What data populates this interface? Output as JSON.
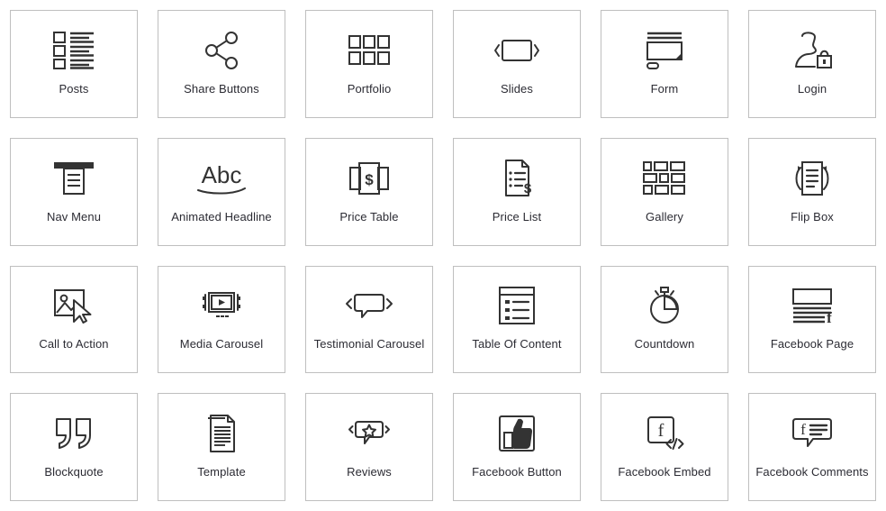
{
  "theme": {
    "background": "#ffffff",
    "card_border": "#bfbfbf",
    "icon_color": "#333333",
    "label_color": "#2b2b33"
  },
  "widget_grid": {
    "columns": 6,
    "rows": 4,
    "items": [
      {
        "label": "Posts",
        "icon": "posts-icon"
      },
      {
        "label": "Share Buttons",
        "icon": "share-buttons-icon"
      },
      {
        "label": "Portfolio",
        "icon": "portfolio-icon"
      },
      {
        "label": "Slides",
        "icon": "slides-icon"
      },
      {
        "label": "Form",
        "icon": "form-icon"
      },
      {
        "label": "Login",
        "icon": "login-icon"
      },
      {
        "label": "Nav Menu",
        "icon": "nav-menu-icon"
      },
      {
        "label": "Animated Headline",
        "icon": "animated-headline-icon"
      },
      {
        "label": "Price Table",
        "icon": "price-table-icon"
      },
      {
        "label": "Price List",
        "icon": "price-list-icon"
      },
      {
        "label": "Gallery",
        "icon": "gallery-icon"
      },
      {
        "label": "Flip Box",
        "icon": "flip-box-icon"
      },
      {
        "label": "Call to Action",
        "icon": "call-to-action-icon"
      },
      {
        "label": "Media Carousel",
        "icon": "media-carousel-icon"
      },
      {
        "label": "Testimonial Carousel",
        "icon": "testimonial-carousel-icon"
      },
      {
        "label": "Table Of Content",
        "icon": "table-of-content-icon"
      },
      {
        "label": "Countdown",
        "icon": "countdown-icon"
      },
      {
        "label": "Facebook Page",
        "icon": "facebook-page-icon"
      },
      {
        "label": "Blockquote",
        "icon": "blockquote-icon"
      },
      {
        "label": "Template",
        "icon": "template-icon"
      },
      {
        "label": "Reviews",
        "icon": "reviews-icon"
      },
      {
        "label": "Facebook Button",
        "icon": "facebook-button-icon"
      },
      {
        "label": "Facebook Embed",
        "icon": "facebook-embed-icon"
      },
      {
        "label": "Facebook Comments",
        "icon": "facebook-comments-icon"
      }
    ]
  }
}
